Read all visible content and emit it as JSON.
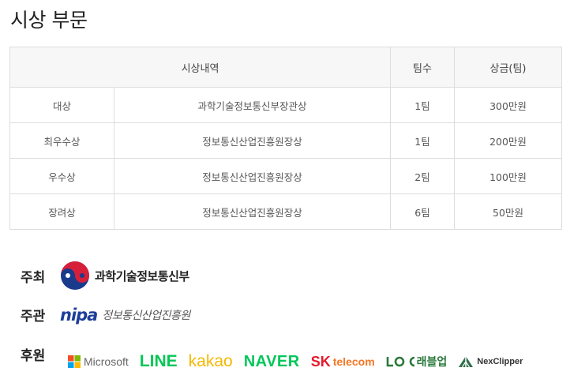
{
  "section_title": "시상 부문",
  "table": {
    "headers": [
      "시상내역",
      "팀수",
      "상금(팀)"
    ],
    "rows": [
      {
        "category": "대상",
        "award": "과학기술정보통신부장관상",
        "teams": "1팀",
        "prize": "300만원"
      },
      {
        "category": "최우수상",
        "award": "정보통신산업진흥원장상",
        "teams": "1팀",
        "prize": "200만원"
      },
      {
        "category": "우수상",
        "award": "정보통신산업진흥원장상",
        "teams": "2팀",
        "prize": "100만원"
      },
      {
        "category": "장려상",
        "award": "정보통신산업진흥원장상",
        "teams": "6팀",
        "prize": "50만원"
      }
    ]
  },
  "host": {
    "label": "주최",
    "org": "과학기술정보통신부"
  },
  "organizer": {
    "label": "주관",
    "logo_word": "nipa",
    "org": "정보통신산업진흥원"
  },
  "sponsor": {
    "label": "후원",
    "logos": {
      "microsoft": "Microsoft",
      "line": "LINE",
      "kakao": "kakao",
      "naver": "NAVER",
      "sk": "SK",
      "telecom": "telecom",
      "rebul": "래블업",
      "nexclipper": "NexClipper"
    }
  },
  "colors": {
    "table_border": "#dddddd",
    "header_bg": "#f7f7f7",
    "nipa_blue": "#1d3f9a",
    "line_green": "#06c755",
    "kakao_yellow": "#f5b800",
    "naver_green": "#03c75a",
    "sk_red": "#e8192c",
    "sk_orange": "#f47725"
  }
}
